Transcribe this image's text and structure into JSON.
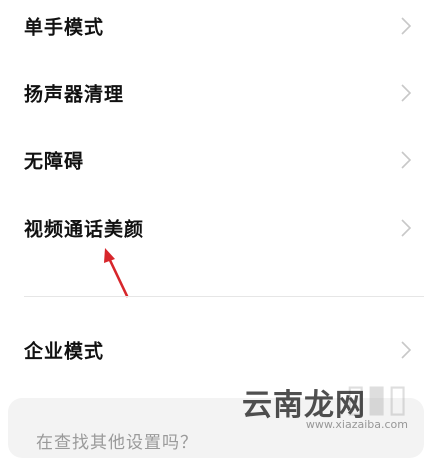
{
  "settings": {
    "items": [
      {
        "label": "单手模式",
        "icon": "chevron-right-icon"
      },
      {
        "label": "扬声器清理",
        "icon": "chevron-right-icon"
      },
      {
        "label": "无障碍",
        "icon": "chevron-right-icon"
      },
      {
        "label": "视频通话美颜",
        "icon": "chevron-right-icon"
      }
    ],
    "enterprise": {
      "label": "企业模式",
      "icon": "chevron-right-icon"
    },
    "search_prompt": "在查找其他设置吗？"
  },
  "watermark": {
    "brand": "云南龙网",
    "url": "www.xiazaiba.com"
  },
  "annotation": {
    "color": "#d7262b",
    "icon": "red-arrow-icon"
  },
  "colors": {
    "text": "#111111",
    "chevron": "#c8c8c8",
    "card": "#f3f3f3"
  }
}
